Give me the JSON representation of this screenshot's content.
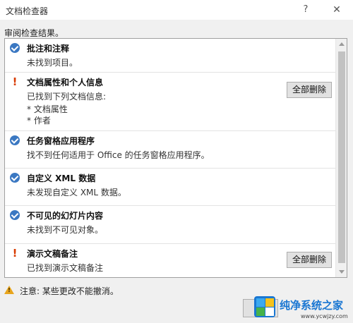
{
  "window": {
    "title": "文档检查器",
    "help_glyph": "?",
    "close_glyph": "✕"
  },
  "subtitle": "审阅检查结果。",
  "items": [
    {
      "status": "ok",
      "title": "批注和注释",
      "description": "未找到项目。"
    },
    {
      "status": "warning",
      "status_glyph": "!",
      "title": "文档属性和个人信息",
      "description": "已找到下列文档信息:",
      "details": [
        "* 文档属性",
        "* 作者"
      ],
      "button_label": "全部删除"
    },
    {
      "status": "ok",
      "title": "任务窗格应用程序",
      "description": "找不到任何适用于 Office 的任务窗格应用程序。"
    },
    {
      "status": "ok",
      "title": "自定义 XML 数据",
      "description": "未发现自定义 XML 数据。"
    },
    {
      "status": "ok",
      "title": "不可见的幻灯片内容",
      "description": "未找到不可见对象。"
    },
    {
      "status": "warning",
      "status_glyph": "!",
      "title": "演示文稿备注",
      "description": "已找到演示文稿备注",
      "button_label": "全部删除"
    }
  ],
  "footer": {
    "warning_text": "注意: 某些更改不能撤消。",
    "warning_glyph": "!"
  },
  "watermark": {
    "title": "纯净系统之家",
    "url": "www.ycwjzy.com"
  },
  "colors": {
    "check": "#3b78c2",
    "warning": "#d83b01",
    "triangle": "#e8a51d",
    "watermark_brand": "#1976d2"
  },
  "icons": {
    "ok": "check-circle-icon",
    "warning": "exclamation-icon",
    "footer": "warning-triangle-icon"
  }
}
